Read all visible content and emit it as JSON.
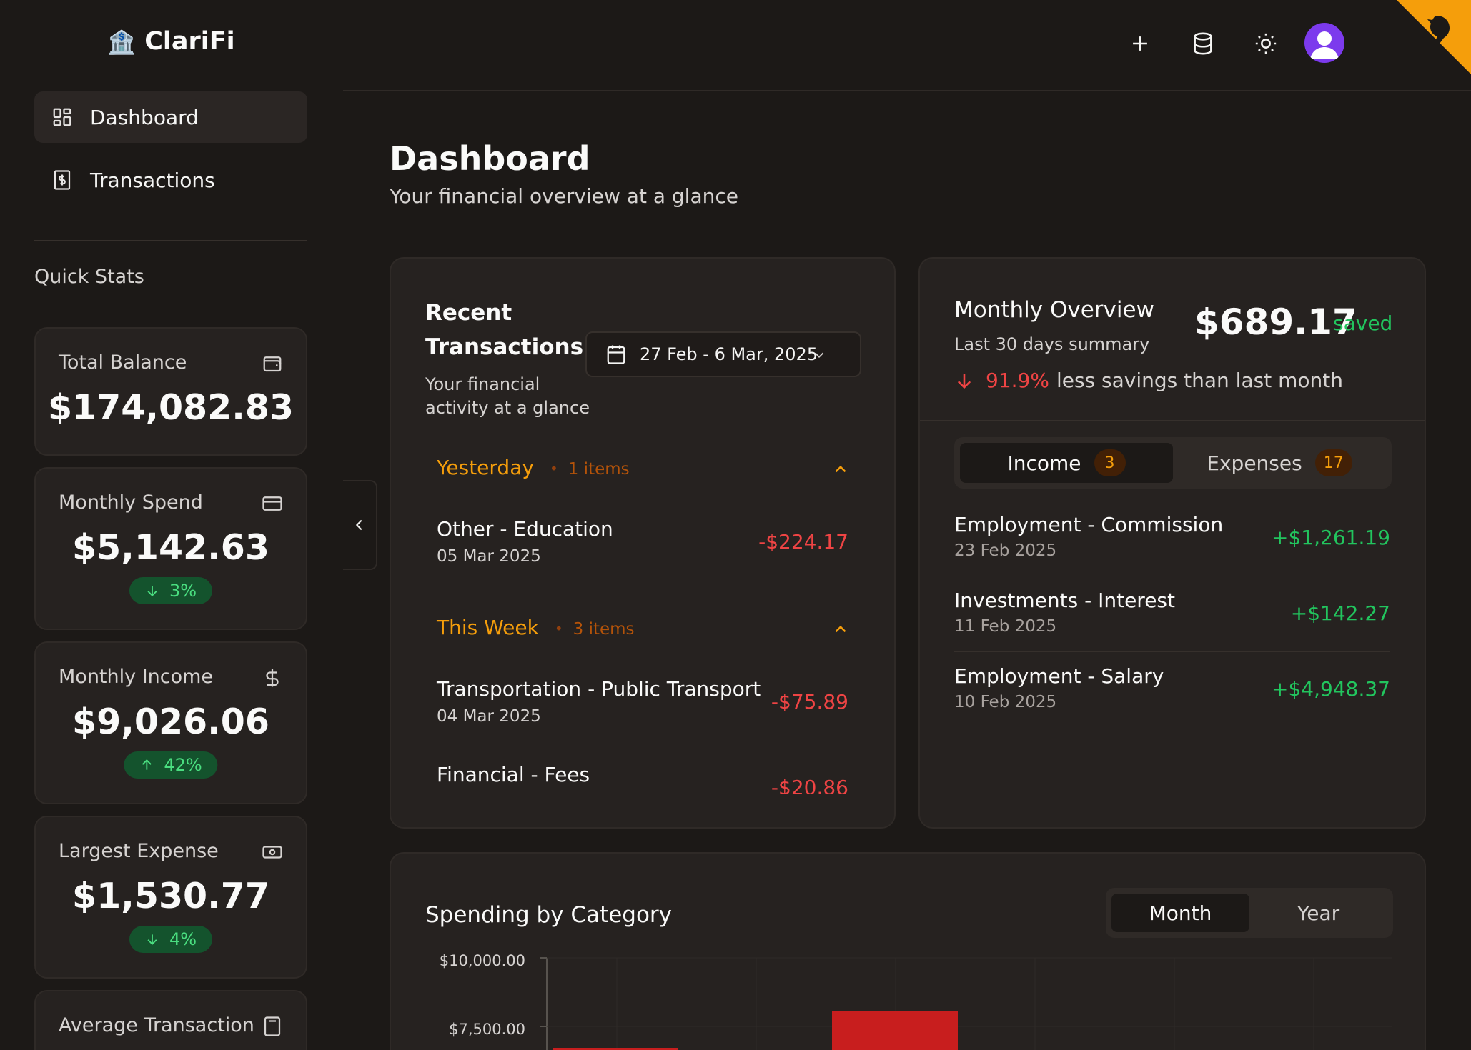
{
  "app": {
    "name": "ClariFi",
    "logo_glyph": "🏦"
  },
  "sidebar": {
    "nav": [
      {
        "label": "Dashboard",
        "icon": "dashboard-icon",
        "active": true
      },
      {
        "label": "Transactions",
        "icon": "receipt-icon",
        "active": false
      }
    ],
    "quick_stats_title": "Quick Stats",
    "stats": [
      {
        "label": "Total Balance",
        "icon": "wallet-icon",
        "value": "$174,082.83"
      },
      {
        "label": "Monthly Spend",
        "icon": "credit-card-icon",
        "value": "$5,142.63",
        "change": "3%",
        "direction": "down"
      },
      {
        "label": "Monthly Income",
        "icon": "dollar-icon",
        "value": "$9,026.06",
        "change": "42%",
        "direction": "up"
      },
      {
        "label": "Largest Expense",
        "icon": "banknote-icon",
        "value": "$1,530.77",
        "change": "4%",
        "direction": "down"
      },
      {
        "label": "Average Transaction",
        "icon": "calculator-icon"
      }
    ]
  },
  "topbar": {
    "icons": [
      "plus-icon",
      "database-icon",
      "sun-icon",
      "user-avatar",
      "github-corner-icon"
    ]
  },
  "page": {
    "title": "Dashboard",
    "subtitle": "Your financial overview at a glance"
  },
  "recent_transactions": {
    "title": "Recent Transactions",
    "subtitle": "Your financial activity at a glance",
    "date_range": "27 Feb - 6 Mar, 2025",
    "groups": [
      {
        "label": "Yesterday",
        "count": "1 items",
        "items": [
          {
            "name": "Other - Education",
            "date": "05 Mar 2025",
            "amount": "-$224.17"
          }
        ]
      },
      {
        "label": "This Week",
        "count": "3 items",
        "items": [
          {
            "name": "Transportation - Public Transport",
            "date": "04 Mar 2025",
            "amount": "-$75.89"
          },
          {
            "name": "Financial - Fees",
            "date": "",
            "amount": "-$20.86"
          }
        ]
      }
    ]
  },
  "monthly_overview": {
    "title": "Monthly Overview",
    "subtitle": "Last 30 days summary",
    "amount": "$689.17",
    "amount_suffix": "saved",
    "trend_pct": "91.9%",
    "trend_text": "less savings than last month",
    "tabs": [
      {
        "label": "Income",
        "count": "3",
        "active": true
      },
      {
        "label": "Expenses",
        "count": "17",
        "active": false
      }
    ],
    "income_items": [
      {
        "name": "Employment - Commission",
        "date": "23 Feb 2025",
        "amount": "+$1,261.19"
      },
      {
        "name": "Investments - Interest",
        "date": "11 Feb 2025",
        "amount": "+$142.27"
      },
      {
        "name": "Employment - Salary",
        "date": "10 Feb 2025",
        "amount": "+$4,948.37"
      }
    ]
  },
  "spending": {
    "title": "Spending by Category",
    "toggle": [
      {
        "label": "Month",
        "active": true
      },
      {
        "label": "Year",
        "active": false
      }
    ],
    "y_ticks": [
      "$10,000.00",
      "$7,500.00"
    ],
    "colors": {
      "bar": "#c81e1e"
    }
  },
  "colors": {
    "accent": "#f59e0b",
    "negative": "#ef4444",
    "positive": "#22c55e",
    "background": "#1c1917",
    "card": "#262220"
  }
}
